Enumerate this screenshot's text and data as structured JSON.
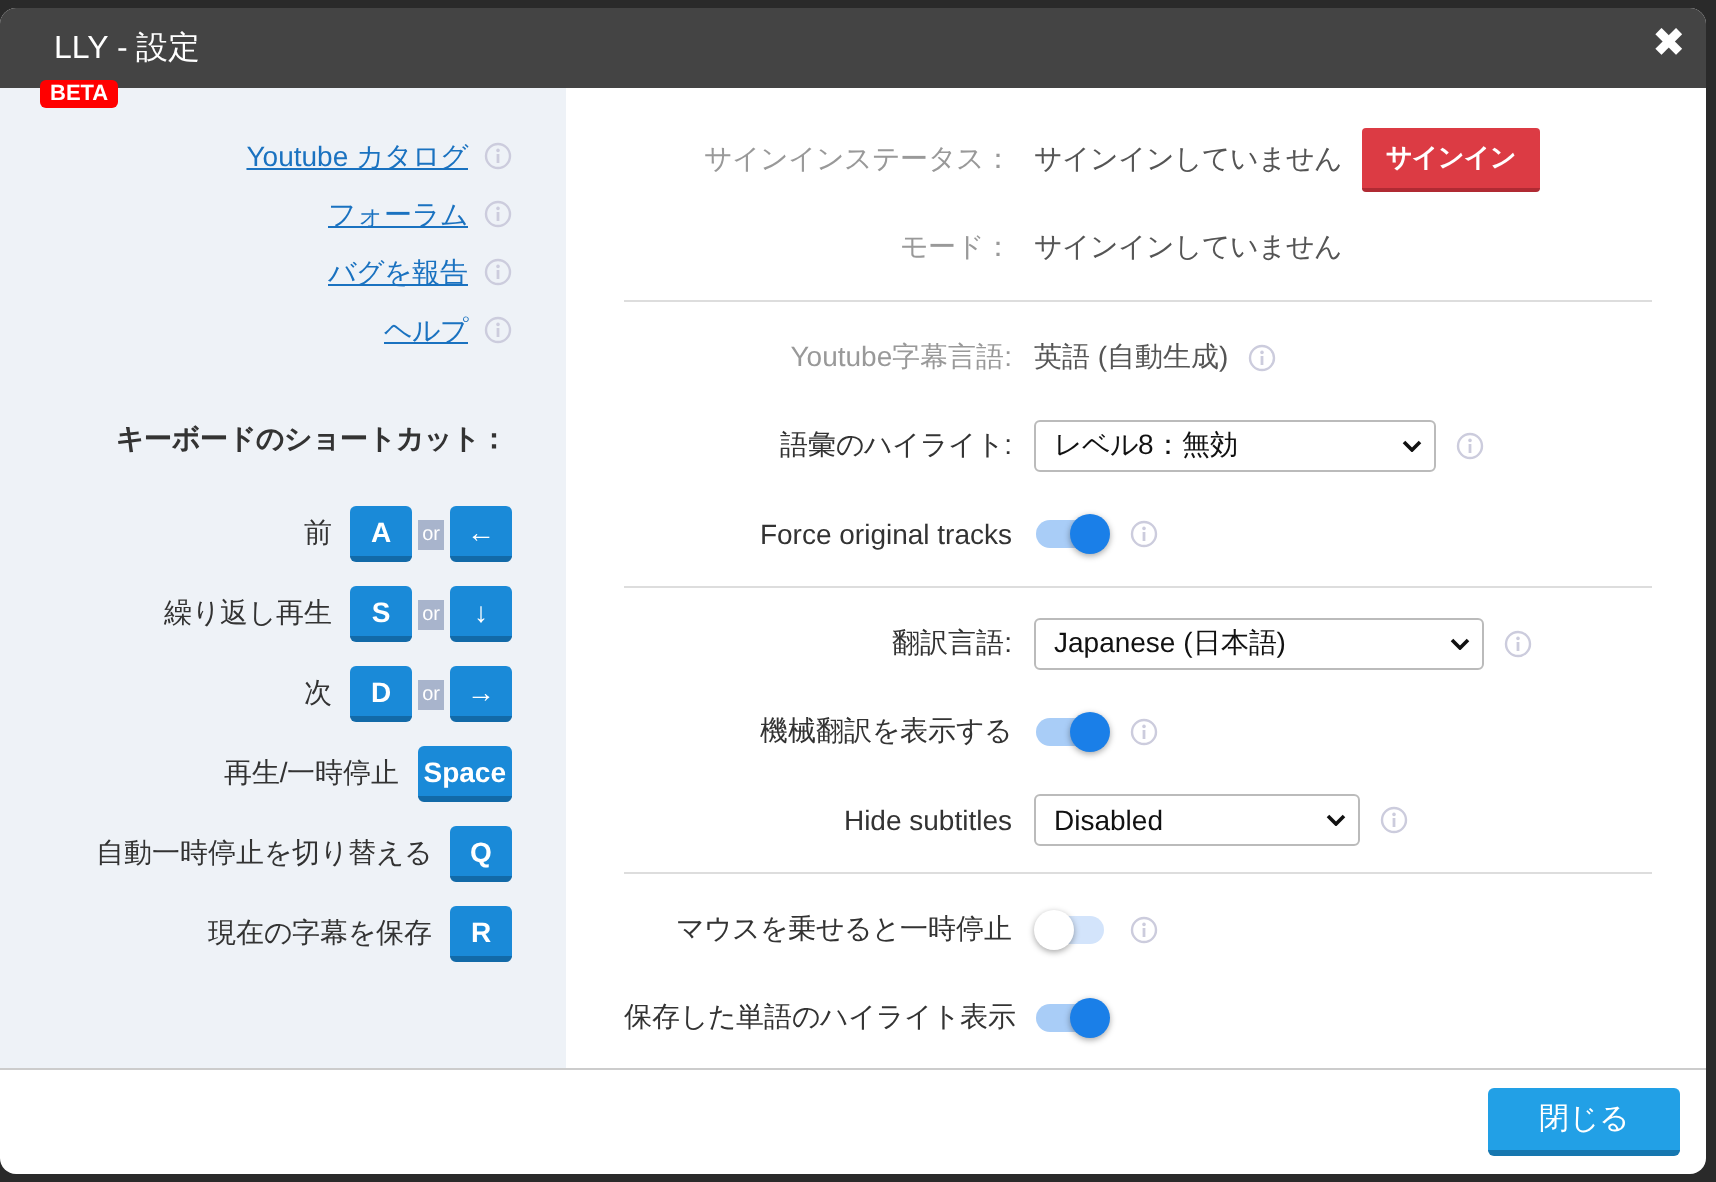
{
  "window": {
    "title": "LLY - 設定",
    "badge": "BETA",
    "close": "✖"
  },
  "links": [
    {
      "label": "Youtube カタログ"
    },
    {
      "label": "フォーラム"
    },
    {
      "label": "バグを報告"
    },
    {
      "label": "ヘルプ"
    }
  ],
  "shortcuts": {
    "title": "キーボードのショートカット：",
    "items": [
      {
        "action": "前",
        "keys": [
          "A",
          "←"
        ],
        "separator": "or"
      },
      {
        "action": "繰り返し再生",
        "keys": [
          "S",
          "↓"
        ],
        "separator": "or"
      },
      {
        "action": "次",
        "keys": [
          "D",
          "→"
        ],
        "separator": "or"
      },
      {
        "action": "再生/一時停止",
        "keys": [
          "Space"
        ]
      },
      {
        "action": "自動一時停止を切り替える",
        "keys": [
          "Q"
        ]
      },
      {
        "action": "現在の字幕を保存",
        "keys": [
          "R"
        ]
      }
    ]
  },
  "settings": [
    {
      "rows": [
        {
          "kind": "status",
          "label": "サインインステータス：",
          "value": "サインインしていません",
          "button": "サインイン"
        },
        {
          "kind": "status",
          "label": "モード：",
          "value": "サインインしていません"
        }
      ]
    },
    {
      "rows": [
        {
          "kind": "info",
          "label": "Youtube字幕言語:",
          "value": "英語 (自動生成)",
          "info": true
        },
        {
          "kind": "select",
          "label": "語彙のハイライト:",
          "value": "レベル8：無効",
          "info": true
        },
        {
          "kind": "toggle",
          "label": "Force original tracks",
          "on": true,
          "info": true
        }
      ]
    },
    {
      "rows": [
        {
          "kind": "select",
          "label": "翻訳言語:",
          "value": "Japanese (日本語)",
          "info": true
        },
        {
          "kind": "toggle",
          "label": "機械翻訳を表示する",
          "on": true,
          "info": true
        },
        {
          "kind": "select",
          "label": "Hide subtitles",
          "value": "Disabled",
          "info": true
        }
      ]
    },
    {
      "rows": [
        {
          "kind": "toggle",
          "label": "マウスを乗せると一時停止",
          "on": false,
          "info": true
        },
        {
          "kind": "toggle",
          "label": "保存した単語のハイライト表示",
          "on": true,
          "info": false
        }
      ]
    }
  ],
  "footer": {
    "button": "閉じる"
  }
}
